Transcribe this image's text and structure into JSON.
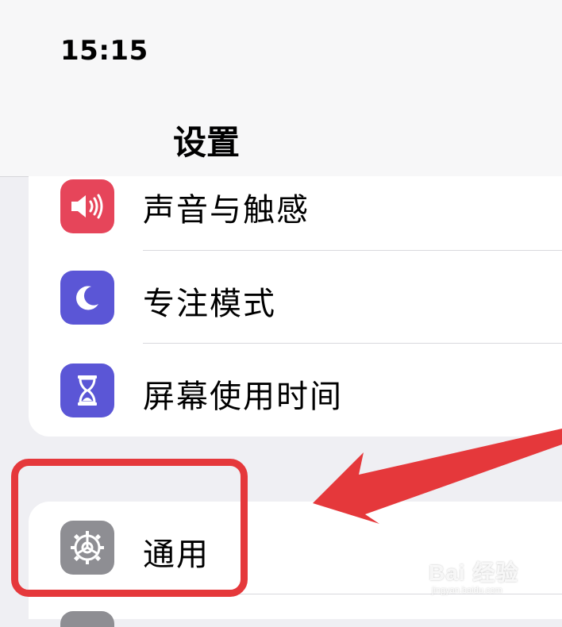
{
  "status_bar": {
    "time": "15:15"
  },
  "nav": {
    "title": "设置"
  },
  "settings_group_1": {
    "items": [
      {
        "label": "声音与触感",
        "icon": "speaker-icon",
        "icon_color": "#e6455a"
      },
      {
        "label": "专注模式",
        "icon": "moon-icon",
        "icon_color": "#5b56d6"
      },
      {
        "label": "屏幕使用时间",
        "icon": "hourglass-icon",
        "icon_color": "#5b56d6"
      }
    ]
  },
  "settings_group_2": {
    "items": [
      {
        "label": "通用",
        "icon": "gear-icon",
        "icon_color": "#8e8e93"
      }
    ]
  },
  "annotation": {
    "highlight_color": "#e5383b"
  },
  "watermark": {
    "brand": "Bai 经验",
    "url": "jingyan.baidu.com"
  }
}
